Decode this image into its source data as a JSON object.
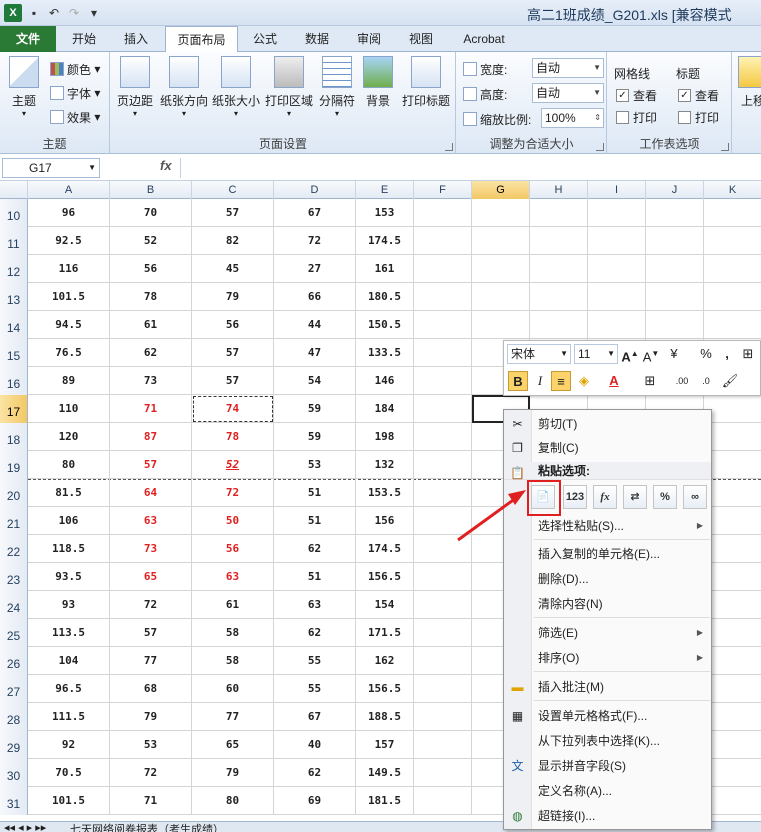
{
  "window": {
    "title": "高二1班成绩_G201.xls [兼容模式"
  },
  "tabs": [
    "文件",
    "开始",
    "插入",
    "页面布局",
    "公式",
    "数据",
    "审阅",
    "视图",
    "Acrobat"
  ],
  "ribbon": {
    "theme_group": {
      "label": "主题",
      "themes": "主题",
      "colors": "颜色",
      "fonts": "字体",
      "effects": "效果"
    },
    "page_setup_group": {
      "label": "页面设置",
      "margins": "页边距",
      "orientation": "纸张方向",
      "size": "纸张大小",
      "print_area": "打印区域",
      "breaks": "分隔符",
      "background": "背景",
      "print_titles": "打印标题"
    },
    "scale_group": {
      "label": "调整为合适大小",
      "width_label": "宽度:",
      "width_value": "自动",
      "height_label": "高度:",
      "height_value": "自动",
      "scale_label": "缩放比例:",
      "scale_value": "100%"
    },
    "sheet_options_group": {
      "label": "工作表选项",
      "gridlines": "网格线",
      "headings": "标题",
      "view": "查看",
      "print": "打印",
      "gridlines_view": true,
      "gridlines_print": false,
      "headings_view": true,
      "headings_print": false
    },
    "arrange_group": {
      "bring_forward": "上移"
    }
  },
  "formula_bar": {
    "name_box": "G17",
    "fx": "fx",
    "formula": ""
  },
  "grid": {
    "columns": [
      "A",
      "B",
      "C",
      "D",
      "E",
      "F",
      "G",
      "H",
      "I",
      "J",
      "K"
    ],
    "selected_column": "G",
    "selected_row": "17",
    "rows": [
      {
        "n": "10",
        "cells": [
          "96",
          "70",
          "57",
          "67",
          "153"
        ],
        "red": []
      },
      {
        "n": "11",
        "cells": [
          "92.5",
          "52",
          "82",
          "72",
          "174.5"
        ],
        "red": []
      },
      {
        "n": "12",
        "cells": [
          "116",
          "56",
          "45",
          "27",
          "161"
        ],
        "red": []
      },
      {
        "n": "13",
        "cells": [
          "101.5",
          "78",
          "79",
          "66",
          "180.5"
        ],
        "red": []
      },
      {
        "n": "14",
        "cells": [
          "94.5",
          "61",
          "56",
          "44",
          "150.5"
        ],
        "red": []
      },
      {
        "n": "15",
        "cells": [
          "76.5",
          "62",
          "57",
          "47",
          "133.5"
        ],
        "red": []
      },
      {
        "n": "16",
        "cells": [
          "89",
          "73",
          "57",
          "54",
          "146"
        ],
        "red": []
      },
      {
        "n": "17",
        "cells": [
          "110",
          "71",
          "74",
          "59",
          "184"
        ],
        "red": [
          1,
          2
        ]
      },
      {
        "n": "18",
        "cells": [
          "120",
          "87",
          "78",
          "59",
          "198"
        ],
        "red": [
          1,
          2
        ]
      },
      {
        "n": "19",
        "cells": [
          "80",
          "57",
          "52",
          "53",
          "132"
        ],
        "red": [
          1,
          2
        ]
      },
      {
        "n": "20",
        "cells": [
          "81.5",
          "64",
          "72",
          "51",
          "153.5"
        ],
        "red": [
          1,
          2
        ]
      },
      {
        "n": "21",
        "cells": [
          "106",
          "63",
          "50",
          "51",
          "156"
        ],
        "red": [
          1,
          2
        ]
      },
      {
        "n": "22",
        "cells": [
          "118.5",
          "73",
          "56",
          "62",
          "174.5"
        ],
        "red": [
          1,
          2
        ]
      },
      {
        "n": "23",
        "cells": [
          "93.5",
          "65",
          "63",
          "51",
          "156.5"
        ],
        "red": [
          1,
          2
        ]
      },
      {
        "n": "24",
        "cells": [
          "93",
          "72",
          "61",
          "63",
          "154"
        ],
        "red": []
      },
      {
        "n": "25",
        "cells": [
          "113.5",
          "57",
          "58",
          "62",
          "171.5"
        ],
        "red": []
      },
      {
        "n": "26",
        "cells": [
          "104",
          "77",
          "58",
          "55",
          "162"
        ],
        "red": []
      },
      {
        "n": "27",
        "cells": [
          "96.5",
          "68",
          "60",
          "55",
          "156.5"
        ],
        "red": []
      },
      {
        "n": "28",
        "cells": [
          "111.5",
          "79",
          "77",
          "67",
          "188.5"
        ],
        "red": []
      },
      {
        "n": "29",
        "cells": [
          "92",
          "53",
          "65",
          "40",
          "157"
        ],
        "red": []
      },
      {
        "n": "30",
        "cells": [
          "70.5",
          "72",
          "79",
          "62",
          "149.5"
        ],
        "red": []
      },
      {
        "n": "31",
        "cells": [
          "101.5",
          "71",
          "80",
          "69",
          "181.5"
        ],
        "red": []
      }
    ]
  },
  "sheet_tab": "七天网络阅卷报表（考生成绩）",
  "mini_toolbar": {
    "font": "宋体",
    "size": "11",
    "bold": "B",
    "italic": "I",
    "percent": "%",
    "comma": ","
  },
  "context_menu": {
    "cut": "剪切(T)",
    "copy": "复制(C)",
    "paste_options": "粘贴选项:",
    "paste_buttons": [
      "",
      "123",
      "fx",
      "",
      "%",
      ""
    ],
    "paste_special": "选择性粘贴(S)...",
    "insert_copied": "插入复制的单元格(E)...",
    "delete": "删除(D)...",
    "clear": "清除内容(N)",
    "filter": "筛选(E)",
    "sort": "排序(O)",
    "insert_comment": "插入批注(M)",
    "format_cells": "设置单元格格式(F)...",
    "pick_list": "从下拉列表中选择(K)...",
    "phonetic": "显示拼音字段(S)",
    "define_name": "定义名称(A)...",
    "hyperlink": "超链接(I)..."
  },
  "colors": {
    "accent_red": "#e02020",
    "file_tab": "#2a7a36",
    "selection": "#f2c866"
  }
}
